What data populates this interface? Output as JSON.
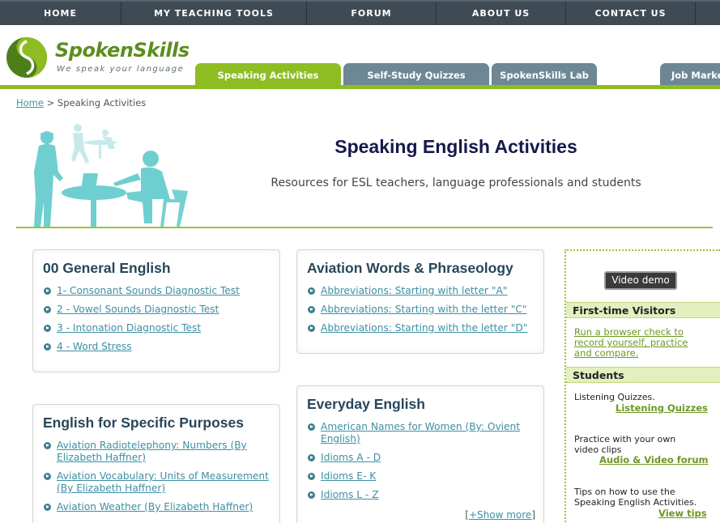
{
  "topnav": {
    "items": [
      "HOME",
      "MY TEACHING TOOLS",
      "FORUM",
      "ABOUT US",
      "CONTACT US"
    ]
  },
  "logo": {
    "name_part1": "Spoken",
    "name_part2": "Skills",
    "tagline": "We speak your language"
  },
  "tabs": [
    {
      "label": "Speaking Activities",
      "active": true
    },
    {
      "label": "Self-Study Quizzes",
      "active": false
    },
    {
      "label": "SpokenSkills Lab",
      "active": false
    },
    {
      "label": "Job Market",
      "active": false
    }
  ],
  "breadcrumb": {
    "home": "Home",
    "separator": ">",
    "current": "Speaking Activities"
  },
  "hero": {
    "title": "Speaking English Activities",
    "subtitle": "Resources for ESL teachers, language professionals and students"
  },
  "boxes": {
    "general": {
      "title": "00 General English",
      "links": [
        "1- Consonant Sounds Diagnostic Test",
        "2 - Vowel Sounds Diagnostic Test",
        "3 - Intonation Diagnostic Test",
        "4 - Word Stress"
      ]
    },
    "aviation": {
      "title": "Aviation Words & Phraseology",
      "links": [
        "Abbreviations: Starting with letter \"A\"",
        "Abbreviations: Starting with the letter \"C\"",
        "Abbreviations: Starting with the letter \"D\""
      ]
    },
    "esp": {
      "title": "English for Specific Purposes",
      "links": [
        "Aviation Radiotelephony: Numbers (By Elizabeth Haffner)",
        "Aviation Vocabulary: Units of Measurement (By Elizabeth Haffner)",
        "Aviation Weather (By Elizabeth Haffner)"
      ]
    },
    "everyday": {
      "title": "Everyday English",
      "links": [
        "American Names for Women (By: Ovient English)",
        "Idioms A - D",
        "Idioms E- K",
        "Idioms L - Z"
      ],
      "show_more_open": "[",
      "show_more": "+Show more",
      "show_more_close": "]"
    }
  },
  "sidebar": {
    "video_button": "Video demo",
    "first_time_heading": "First-time Visitors",
    "first_time_link": "Run a browser check to record yourself, practice and compare.",
    "students_heading": "Students",
    "listening_text": "Listening Quizzes.",
    "listening_link": "Listening Quizzes",
    "practice_text": "Practice with your own video clips",
    "practice_link": "Audio & Video forum",
    "tips_text": "Tips on how to use the Speaking English Activities.",
    "tips_link": "View tips"
  },
  "colors": {
    "nav_bg": "#3e4b55",
    "accent_green": "#8ebd23",
    "tab_inactive": "#6d8795",
    "link_blue": "#3d8fa4",
    "heading_navy": "#16194a",
    "figure_teal": "#6fcfd0"
  }
}
